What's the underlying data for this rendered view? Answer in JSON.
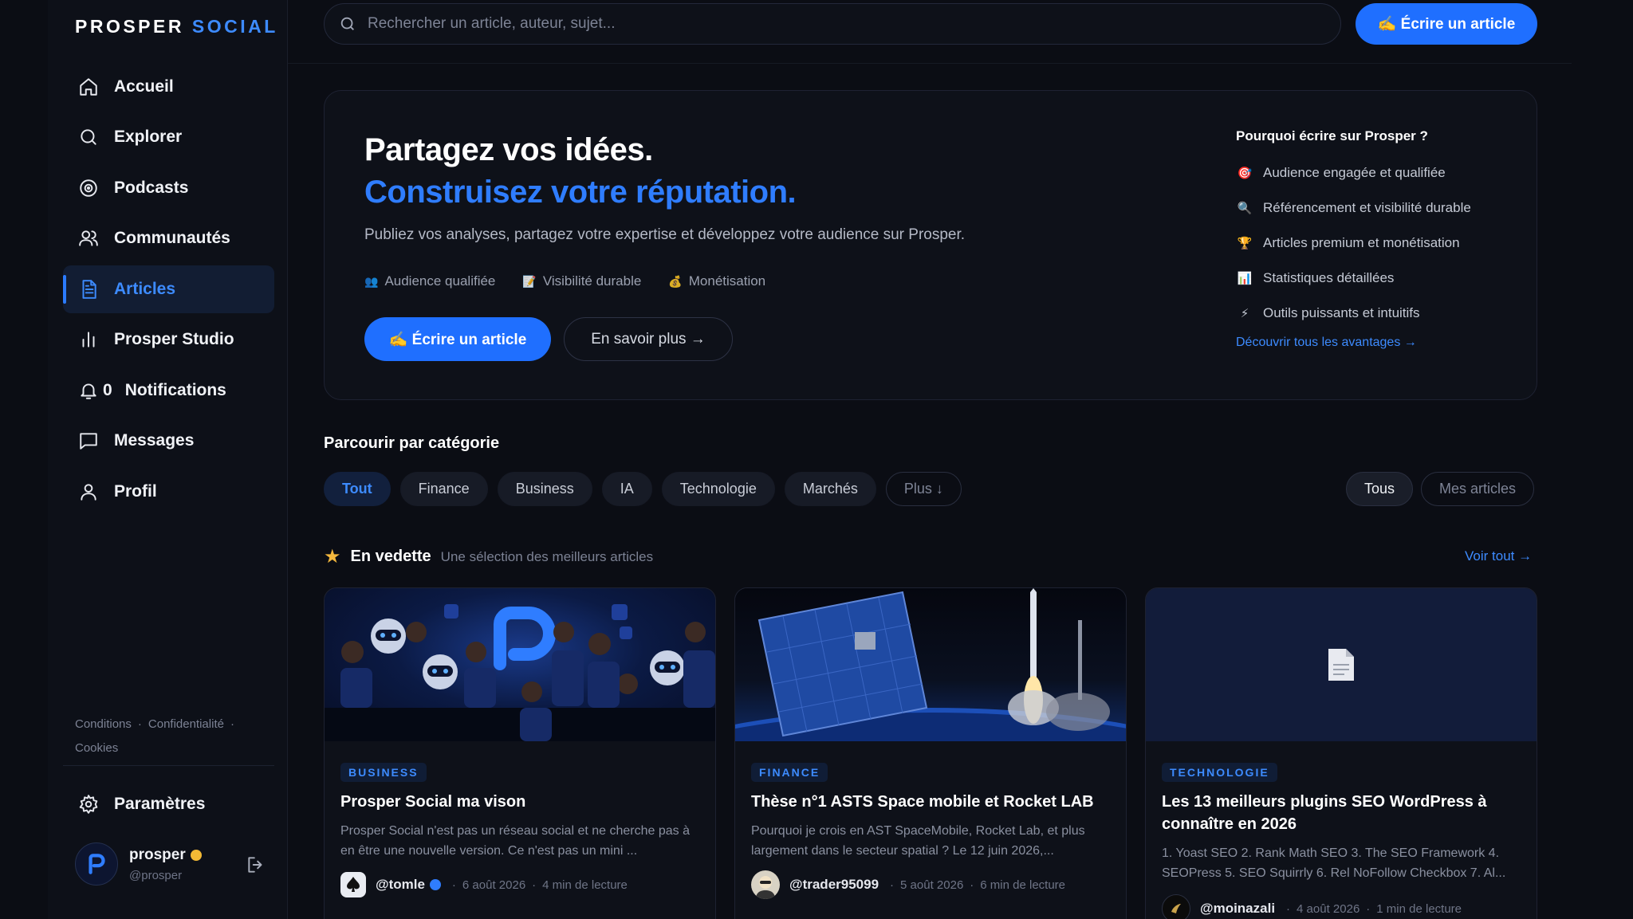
{
  "brand": {
    "name_part1": "PROSPER",
    "name_part2": "SOCIAL"
  },
  "nav": [
    {
      "label": "Accueil",
      "icon": "home-icon"
    },
    {
      "label": "Explorer",
      "icon": "search-icon"
    },
    {
      "label": "Podcasts",
      "icon": "podcast-icon"
    },
    {
      "label": "Communautés",
      "icon": "users-icon"
    },
    {
      "label": "Articles",
      "icon": "document-icon",
      "active": true
    },
    {
      "label": "Prosper Studio",
      "icon": "bar-chart-icon"
    },
    {
      "label": "Notifications",
      "icon": "bell-icon",
      "count": "0"
    },
    {
      "label": "Messages",
      "icon": "message-icon"
    },
    {
      "label": "Profil",
      "icon": "user-icon"
    }
  ],
  "footer_links": {
    "conditions": "Conditions",
    "privacy": "Confidentialité",
    "cookies": "Cookies"
  },
  "settings": {
    "label": "Paramètres"
  },
  "profile": {
    "name": "prosper",
    "handle": "@prosper"
  },
  "search": {
    "placeholder": "Rechercher un article, auteur, sujet..."
  },
  "top_write": "✍️ Écrire un article",
  "hero": {
    "title1": "Partagez vos idées.",
    "title2": "Construisez votre réputation.",
    "subtitle": "Publiez vos analyses, partagez votre expertise et développez votre audience sur Prosper.",
    "features": [
      {
        "glyph": "👥",
        "label": "Audience qualifiée"
      },
      {
        "glyph": "📝",
        "label": "Visibilité durable"
      },
      {
        "glyph": "💰",
        "label": "Monétisation"
      }
    ],
    "write_button": "✍️ Écrire un article",
    "more_button": "En savoir plus →",
    "why_title": "Pourquoi écrire sur Prosper ?",
    "why_items": [
      {
        "glyph": "🎯",
        "label": "Audience engagée et qualifiée"
      },
      {
        "glyph": "🔍",
        "label": "Référencement et visibilité durable"
      },
      {
        "glyph": "🏆",
        "label": "Articles premium et monétisation"
      },
      {
        "glyph": "📊",
        "label": "Statistiques détaillées"
      },
      {
        "glyph": "⚡",
        "label": "Outils puissants et intuitifs"
      }
    ],
    "why_link": "Découvrir tous les avantages →"
  },
  "categories": {
    "title": "Parcourir par catégorie",
    "chips": [
      "Tout",
      "Finance",
      "Business",
      "IA",
      "Technologie",
      "Marchés",
      "Plus ↓"
    ],
    "filters": [
      "Tous",
      "Mes articles"
    ]
  },
  "featured": {
    "title": "En vedette",
    "subtitle": "Une sélection des meilleurs articles",
    "see_all": "Voir tout →",
    "cards": [
      {
        "category": "BUSINESS",
        "title": "Prosper Social ma vison",
        "excerpt": "Prosper Social n'est pas un réseau social et ne cherche pas à en être une nouvelle version. Ce n'est pas un mini ...",
        "author": "@tomle",
        "date": "6 août 2026",
        "read": "4 min de lecture"
      },
      {
        "category": "FINANCE",
        "title": "Thèse n°1 ASTS Space mobile et Rocket LAB",
        "excerpt": "Pourquoi je crois en AST SpaceMobile, Rocket Lab, et plus largement dans le secteur spatial ? Le 12 juin 2026,...",
        "author": "@trader95099",
        "date": "5 août 2026",
        "read": "6 min de lecture"
      },
      {
        "category": "TECHNOLOGIE",
        "title": "Les 13 meilleurs plugins SEO WordPress à connaître en 2026",
        "excerpt": "1. Yoast SEO 2. Rank Math SEO 3. The SEO Framework 4. SEOPress 5. SEO Squirrly 6. Rel NoFollow Checkbox 7. Al...",
        "author": "@moinazali",
        "date": "4 août 2026",
        "read": "1 min de lecture"
      }
    ]
  }
}
